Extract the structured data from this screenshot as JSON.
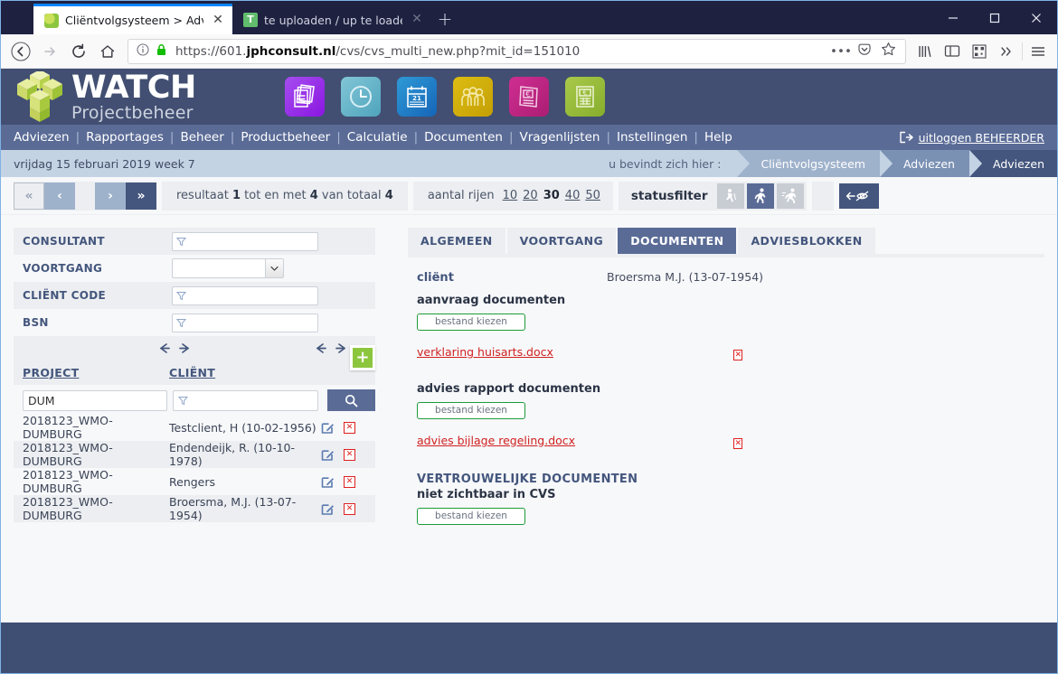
{
  "browser": {
    "tabs": [
      {
        "title": "Cliëntvolgsysteem > Adviezen",
        "title_faded": " >",
        "favicon": "puzzle-green-icon",
        "active": true
      },
      {
        "title": "te uploaden / up te loaden* - ",
        "title_faded": "ta",
        "favicon": "text-editor-icon",
        "active": false
      }
    ],
    "new_tab_label": "+",
    "window_controls": {
      "minimize": "minimize-icon",
      "maximize": "maximize-icon",
      "close": "close-icon"
    },
    "url": {
      "scheme": "https://601.",
      "host": "jphconsult.nl",
      "path": "/cvs/cvs_multi_new.php?mit_id=151010"
    },
    "nav_icons": [
      "back-arrow-icon",
      "forward-arrow-icon",
      "reload-icon",
      "home-icon"
    ],
    "url_icons": [
      "info-icon",
      "lock-icon"
    ],
    "url_right_icons": [
      "more-dots-icon",
      "pocket-icon",
      "bookmark-star-icon"
    ],
    "toolbar_icons": [
      "library-icon",
      "sidebar-icon",
      "qr-screenshot-icon",
      "overflow-chevrons-icon",
      "hamburger-menu-icon"
    ]
  },
  "app": {
    "logo": {
      "title": "WATCH",
      "subtitle": "Projectbeheer",
      "icon": "watch-cube-logo"
    },
    "app_icons": [
      {
        "name": "documents-icon",
        "color": "#9b30e0"
      },
      {
        "name": "clock-icon",
        "color": "#66b8cc"
      },
      {
        "name": "calendar-21-icon",
        "color": "#1f7ec4"
      },
      {
        "name": "people-group-icon",
        "color": "#d4b106"
      },
      {
        "name": "euro-invoice-icon",
        "color": "#c2257f"
      },
      {
        "name": "euro-calculator-icon",
        "color": "#9bbf3a"
      }
    ],
    "menu": [
      "Adviezen",
      "Rapportages",
      "Beheer",
      "Productbeheer",
      "Calculatie",
      "Documenten",
      "Vragenlijsten",
      "Instellingen",
      "Help"
    ],
    "menu_separator": "|",
    "logout": {
      "label": "uitloggen BEHEERDER",
      "icon": "logout-icon"
    }
  },
  "breadcrumb": {
    "date": "vrijdag 15 februari 2019   week 7",
    "here_label": "u bevindt zich hier :",
    "crumbs": [
      "Cliëntvolgsysteem",
      "Adviezen",
      "Adviezen"
    ]
  },
  "toolbar": {
    "pager": {
      "first": "«",
      "prev": "‹",
      "next": "›",
      "last": "»"
    },
    "result_prefix": "resultaat",
    "result_from": "1",
    "result_mid": "tot en met",
    "result_to": "4",
    "result_of": "van totaal",
    "result_total": "4",
    "rows_label": "aantal rijen",
    "rows_options": [
      "10",
      "20",
      "30",
      "40",
      "50"
    ],
    "rows_selected": "30",
    "statusfilter_label": "statusfilter",
    "status_icons": [
      "walking-slow-icon",
      "running-icon",
      "running-fast-icon"
    ],
    "status_active_index": 1,
    "eye_button": "back-hide-icon"
  },
  "filters": {
    "rows": [
      {
        "label": "CONSULTANT",
        "type": "text",
        "value": "",
        "icon": "funnel-icon"
      },
      {
        "label": "VOORTGANG",
        "type": "select",
        "value": "",
        "icon": "chevron-down-icon"
      },
      {
        "label": "CLIËNT CODE",
        "type": "text",
        "value": "",
        "icon": "funnel-icon"
      },
      {
        "label": "BSN",
        "type": "text",
        "value": "",
        "icon": "funnel-icon"
      }
    ],
    "add_button": "+"
  },
  "table": {
    "columns": [
      "PROJECT",
      "CLIËNT"
    ],
    "search": {
      "project_value": "DUM",
      "client_value": "",
      "client_icon": "funnel-icon",
      "button_icon": "search-icon"
    },
    "rows": [
      {
        "project": "2018123_WMO-DUMBURG",
        "client": "Testclient, H (10-02-1956)"
      },
      {
        "project": "2018123_WMO-DUMBURG",
        "client": "Endendeijk, R. (10-10-1978)"
      },
      {
        "project": "2018123_WMO-DUMBURG",
        "client": "Rengers"
      },
      {
        "project": "2018123_WMO-DUMBURG",
        "client": "Broersma, M.J. (13-07-1954)"
      }
    ],
    "row_actions": {
      "edit": "edit-pencil-icon",
      "delete": "delete-x-icon"
    }
  },
  "detail": {
    "tabs": [
      "ALGEMEEN",
      "VOORTGANG",
      "DOCUMENTEN",
      "ADVIESBLOKKEN"
    ],
    "active_tab": "DOCUMENTEN",
    "client_label": "cliënt",
    "client_value": "Broersma M.J. (13-07-1954)",
    "sections": [
      {
        "heading": "aanvraag documenten",
        "choose_label": "bestand kiezen",
        "files": [
          {
            "name": "verklaring huisarts.docx",
            "delete_icon": "delete-x-icon"
          }
        ]
      },
      {
        "heading": "advies rapport documenten",
        "choose_label": "bestand kiezen",
        "files": [
          {
            "name": "advies bijlage regeling.docx",
            "delete_icon": "delete-x-icon"
          }
        ]
      }
    ],
    "confidential": {
      "heading_1": "VERTROUWELIJKE DOCUMENTEN",
      "heading_2": "niet zichtbaar in CVS",
      "choose_label": "bestand kiezen"
    }
  },
  "colors": {
    "header_bg": "#424f72",
    "menu_bg": "#5a6b96",
    "breadcrumb_bg": "#c4d3e4",
    "accent_dark": "#44567d",
    "accent_green": "#8cc63e",
    "danger_red": "#d02020",
    "footer_bg": "#3f4f73"
  }
}
